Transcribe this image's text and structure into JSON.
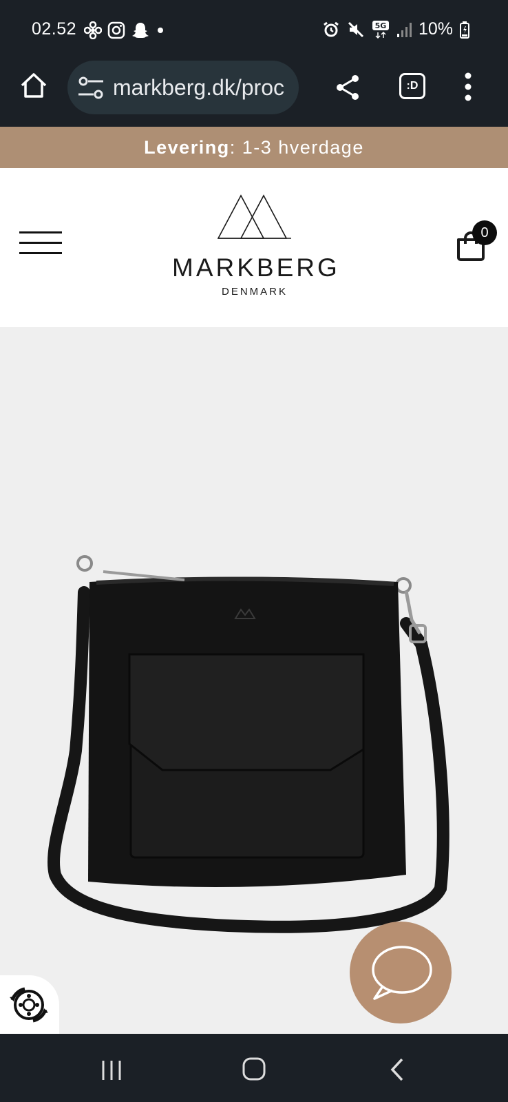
{
  "status_bar": {
    "time": "02.52",
    "battery": "10%",
    "network": "5G",
    "left_icons": [
      "fan-icon",
      "instagram-icon",
      "snapchat-icon",
      "dot-icon"
    ],
    "right_icons": [
      "alarm-icon",
      "mute-icon",
      "5g-icon",
      "signal-icon",
      "battery-icon"
    ]
  },
  "browser": {
    "url": "markberg.dk/proc",
    "tab_label": ":D"
  },
  "promo": {
    "label": "Levering",
    "separator": ":",
    "value": " 1-3 hverdage"
  },
  "header": {
    "brand_name": "MARKBERG",
    "brand_sub": "DENMARK",
    "cart_count": "0"
  },
  "colors": {
    "promo_bg": "#ae8f74",
    "chat_bg": "#b78f71",
    "system_bar": "#1b2026"
  }
}
